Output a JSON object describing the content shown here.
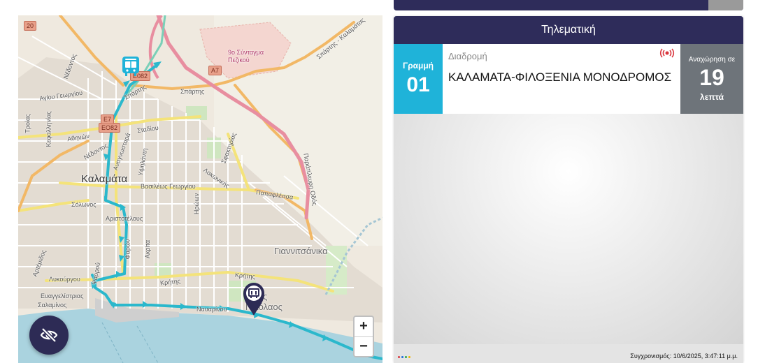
{
  "map": {
    "place_labels": {
      "kalamata": "Καλαμάτα",
      "giannitsanika": "Γιαννιτσάνικα",
      "agios_nikolaos": "Άγιος Νικόλαος",
      "syntagma": "9ο Σύνταγμα\nΠεζικού"
    },
    "street_labels": {
      "agiou_georgiou": "Αγίου Γεωργίου",
      "athinon": "Αθηνών",
      "spartis1": "Σπάρτης",
      "spartis2": "Σπάρτης",
      "stadiou": "Σταδίου",
      "nedontos": "Νέδοντος",
      "vasileos_georgiou": "Βασιλέως Γεωργίου",
      "papaflessa": "Παπαφλέσσα",
      "solonos": "Σόλωνος",
      "aristotelous": "Αριστοτέλους",
      "lykourgou": "Λυκούργου",
      "kritis": "Κρήτης",
      "kritis2": "Κρήτης",
      "evangelistrias": "Ευαγγελίστριας",
      "salaminos": "Σαλαμίνος",
      "navarinou": "Ναυαρίνου",
      "artemidos": "Αρτέμιδος",
      "akritas": "Ακρίτα",
      "farron": "Φαρών",
      "iroon": "Ηρώων",
      "lakonikis": "Λακωνικής",
      "sfaktirias": "Σφακτηρίας",
      "paraplevri": "Παράπλευρη Οδός",
      "spartis_kalamatas": "Σπάρτης - Καλαμάτας",
      "troias": "Τροίας",
      "nedontos2": "Νέδοντος",
      "kefallinias": "Κεφαλληνίας",
      "anagnostara": "Αναγνωσταρά",
      "ypsilanti": "Υψηλάντη",
      "psarrou": "Ψαρρού"
    },
    "shields": {
      "a7": "A7",
      "e65": "ΕΟ82",
      "e7": "E7",
      "e082b": "Ε082",
      "num20": "20"
    },
    "zoom_in_label": "+",
    "zoom_out_label": "−",
    "route_color": "#2bb8cc",
    "hide_icon": "eye-slash-icon"
  },
  "panel": {
    "title": "Τηλεματική",
    "line_label": "Γραμμή",
    "line_number": "01",
    "route_label": "Διαδρομή",
    "route_name": "ΚΑΛΑΜΑΤΑ-ΦΙΛΟΞΕΝΙΑ ΜΟΝΟΔΡΟΜΟΣ",
    "departure_label": "Αναχώρηση σε",
    "departure_minutes": "19",
    "departure_unit": "λεπτά",
    "signal_icon": "live-signal-icon",
    "sync_text": "Συγχρονισμός: 10/6/2025, 3:47:11 μ.μ.",
    "accent_color": "#1fb3d9",
    "header_color": "#2e2c5a"
  }
}
